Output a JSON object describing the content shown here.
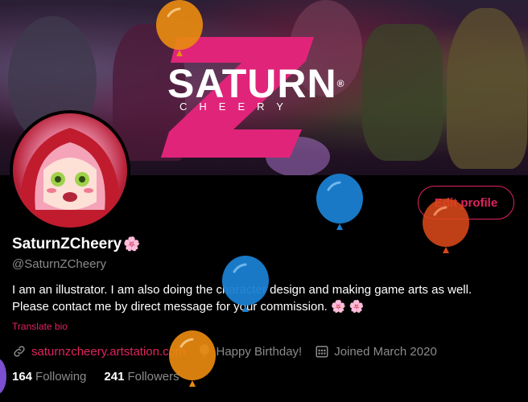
{
  "banner": {
    "logo_title": "SATURN",
    "logo_subtitle": "CHEERY",
    "logo_registered": "®",
    "accent_color": "#e0247a"
  },
  "profile": {
    "display_name": "SaturnZCheery",
    "name_emoji": "🌸",
    "handle": "@SaturnZCheery",
    "bio": "I am an illustrator.  I am also doing the character design and making game arts as well.  Please contact me by direct message for your commission. 🌸 🌸",
    "translate_label": "Translate bio",
    "edit_profile_label": "Edit profile",
    "website": "saturnzcheery.artstation.com",
    "birthday": "Happy Birthday!",
    "joined": "Joined March 2020",
    "following_count": "164",
    "following_label": "Following",
    "followers_count": "241",
    "followers_label": "Followers"
  },
  "icons": {
    "website": "link-icon",
    "birthday": "balloon-icon",
    "joined": "calendar-icon"
  },
  "colors": {
    "accent": "#e0245e",
    "background": "#000000",
    "muted_text": "#8b8b8b",
    "balloon_orange": "#e88a10",
    "balloon_blue": "#1a7fd1",
    "balloon_red": "#d9481a"
  }
}
